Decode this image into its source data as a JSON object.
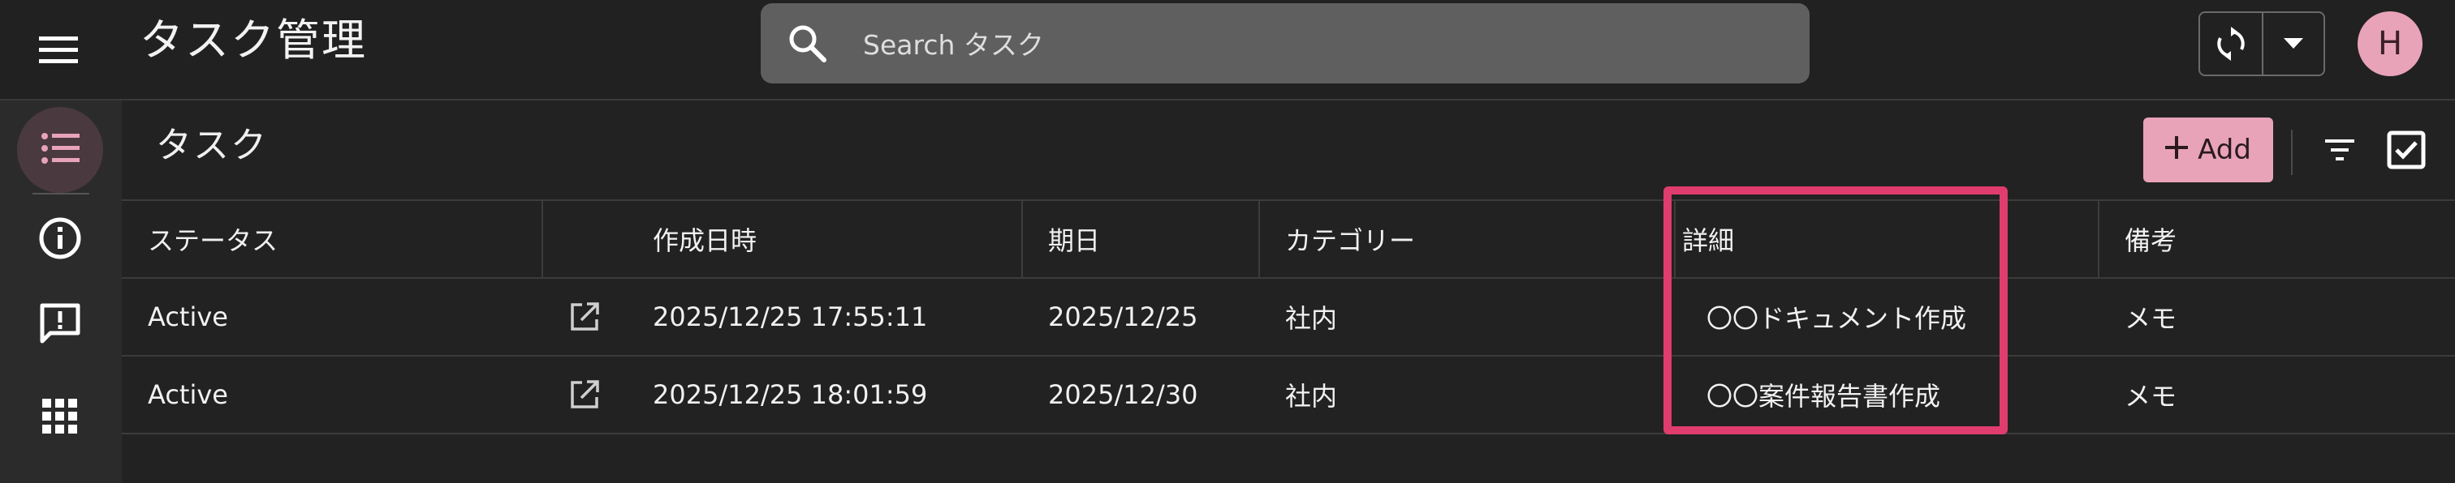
{
  "header": {
    "menu_icon": "hamburger-menu-icon",
    "app_title": "タスク管理",
    "search_placeholder": "Search タスク",
    "sync_icon": "sync-icon",
    "dropdown_icon": "caret-down-icon",
    "avatar_initial": "H"
  },
  "sidebar": {
    "items": [
      {
        "icon": "list-icon",
        "active": true
      },
      {
        "icon": "info-icon",
        "active": false
      },
      {
        "icon": "feedback-icon",
        "active": false
      },
      {
        "icon": "apps-grid-icon",
        "active": false
      }
    ]
  },
  "content": {
    "title": "タスク",
    "add_label": "Add",
    "filter_icon": "filter-icon",
    "select_icon": "checkbox-icon"
  },
  "table": {
    "columns": [
      "ステータス",
      "",
      "作成日時",
      "期日",
      "カテゴリー",
      "詳細",
      "備考"
    ],
    "rows": [
      {
        "status": "Active",
        "created": "2025/12/25 17:55:11",
        "due": "2025/12/25",
        "category": "社内",
        "detail": "〇〇ドキュメント作成",
        "note": "メモ"
      },
      {
        "status": "Active",
        "created": "2025/12/25 18:01:59",
        "due": "2025/12/30",
        "category": "社内",
        "detail": "〇〇案件報告書作成",
        "note": "メモ"
      }
    ]
  },
  "colors": {
    "accent": "#e8a3b9",
    "highlight": "#e03c6d",
    "background": "#222222"
  }
}
